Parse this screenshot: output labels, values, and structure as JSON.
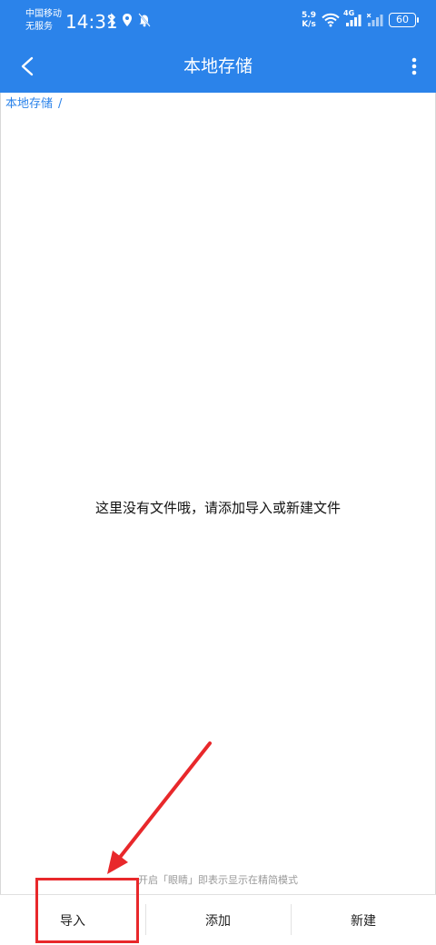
{
  "status_bar": {
    "carrier_line1": "中国移动",
    "carrier_line2": "无服务",
    "time": "14:31",
    "net_speed_value": "5.9",
    "net_speed_unit": "K/s",
    "network_type": "4G",
    "battery": "60"
  },
  "app_bar": {
    "title": "本地存储",
    "icons": [
      "back-arrow-icon",
      "more-vert-icon"
    ]
  },
  "breadcrumb": {
    "root": "本地存储",
    "separator": "/"
  },
  "empty_state": {
    "message": "这里没有文件哦，请添加导入或新建文件"
  },
  "hint": {
    "text": "开启「眼睛」即表示显示在精简模式"
  },
  "bottom_bar": {
    "import_label": "导入",
    "add_label": "添加",
    "new_label": "新建"
  },
  "annotation": {
    "highlight_color": "#e8282b",
    "target": "import"
  },
  "colors": {
    "primary": "#2b83ea",
    "background": "#ffffff"
  }
}
